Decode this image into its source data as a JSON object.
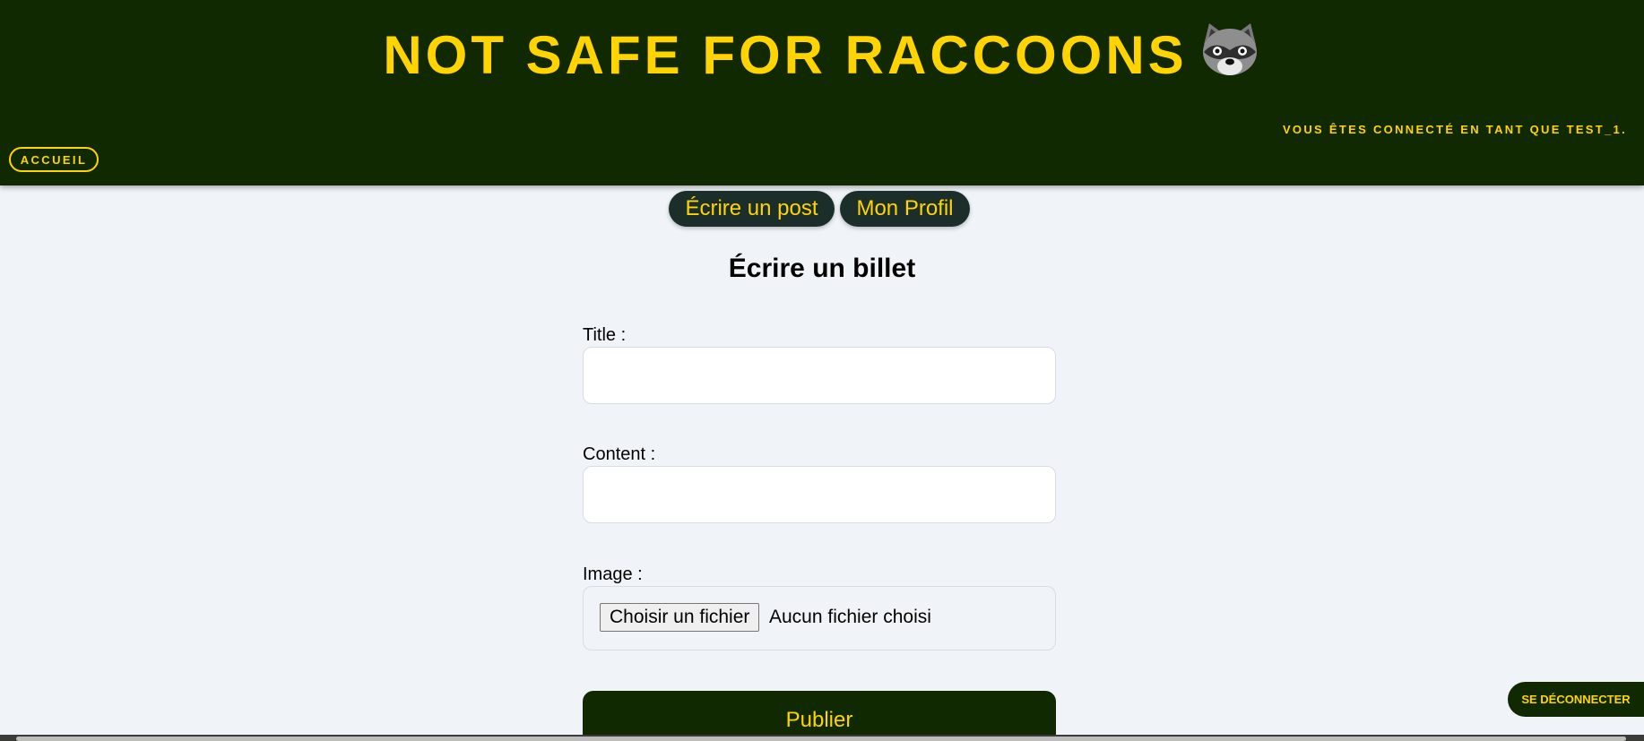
{
  "header": {
    "title": "NOT SAFE FOR RACCOONS",
    "logged_in_text": "VOUS ÊTES CONNECTÉ EN TANT QUE TEST_1.",
    "home_button": "ACCUEIL"
  },
  "nav": {
    "write_post": "Écrire un post",
    "my_profile": "Mon Profil"
  },
  "form": {
    "heading": "Écrire un billet",
    "title_label": "Title :",
    "title_value": "",
    "content_label": "Content :",
    "content_value": "",
    "image_label": "Image :",
    "file_button": "Choisir un fichier",
    "file_status": "Aucun fichier choisi",
    "submit": "Publier"
  },
  "logout_button": "SE DÉCONNECTER",
  "colors": {
    "header_bg": "#112900",
    "accent": "#ffd400",
    "page_bg": "#f0f4f8",
    "pill_bg": "#1c2e2a"
  }
}
